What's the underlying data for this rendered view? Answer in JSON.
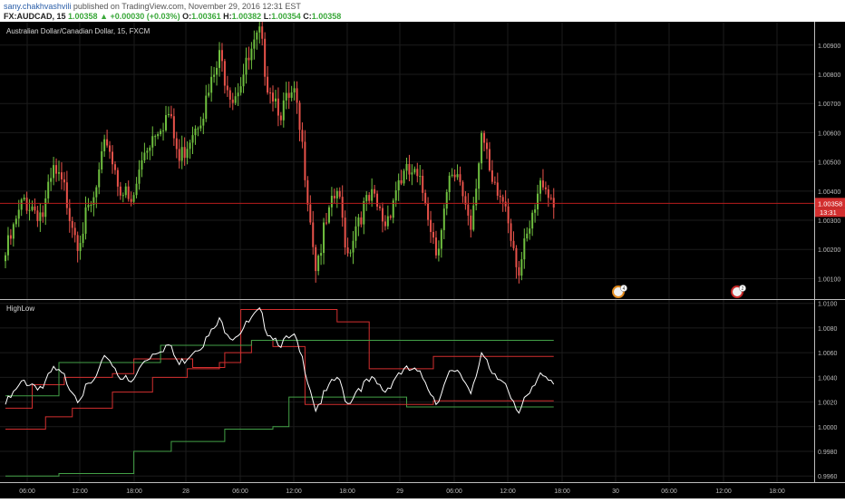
{
  "header": {
    "author": "sany.chakhvashvili",
    "published": "published on TradingView.com, November 29, 2016 12:31 EST",
    "symbol": "FX:AUDCAD, 15",
    "last": "1.00358",
    "change": "▲ +0.00030 (+0.03%)",
    "o_label": "O:",
    "o": "1.00361",
    "h_label": "H:",
    "h": "1.00382",
    "l_label": "L:",
    "l": "1.00354",
    "c_label": "C:",
    "c": "1.00358"
  },
  "colors": {
    "bull": "#6fbf3f",
    "bear": "#e8524a",
    "grid": "#1c1c1c",
    "last_line": "#b71c1c",
    "price_tag": "#d32f2f",
    "upper_band": "#d32f2f",
    "lower_band": "#43a047",
    "close_line": "#ffffff"
  },
  "chart_data": [
    {
      "type": "candlestick",
      "title": "Australian Dollar/Canadian Dollar, 15, FXCM",
      "ylim": [
        1.0003,
        1.0098
      ],
      "y_ticks": [
        "1.00900",
        "1.00800",
        "1.00700",
        "1.00600",
        "1.00500",
        "1.00400",
        "1.00300",
        "1.00200",
        "1.00100"
      ],
      "x_ticks": [
        "06:00",
        "12:00",
        "18:00",
        "28",
        "06:00",
        "12:00",
        "18:00",
        "29",
        "06:00",
        "12:00",
        "18:00",
        "30",
        "06:00",
        "12:00",
        "18:00"
      ],
      "last_price": "1.00358",
      "countdown": "13:31",
      "event_badges": [
        "4",
        "2"
      ],
      "anchors": [
        {
          "i": 0,
          "p": 1.0018
        },
        {
          "i": 7,
          "p": 1.0037
        },
        {
          "i": 14,
          "p": 1.0032
        },
        {
          "i": 18,
          "p": 1.0046
        },
        {
          "i": 22,
          "p": 1.004
        },
        {
          "i": 27,
          "p": 1.0024
        },
        {
          "i": 33,
          "p": 1.0036
        },
        {
          "i": 38,
          "p": 1.0058
        },
        {
          "i": 42,
          "p": 1.0044
        },
        {
          "i": 47,
          "p": 1.0034
        },
        {
          "i": 52,
          "p": 1.0054
        },
        {
          "i": 57,
          "p": 1.0063
        },
        {
          "i": 61,
          "p": 1.0066
        },
        {
          "i": 65,
          "p": 1.005
        },
        {
          "i": 70,
          "p": 1.0062
        },
        {
          "i": 75,
          "p": 1.007
        },
        {
          "i": 80,
          "p": 1.0085
        },
        {
          "i": 85,
          "p": 1.0073
        },
        {
          "i": 90,
          "p": 1.0082
        },
        {
          "i": 95,
          "p": 1.0093
        },
        {
          "i": 98,
          "p": 1.0078
        },
        {
          "i": 103,
          "p": 1.0068
        },
        {
          "i": 108,
          "p": 1.0072
        },
        {
          "i": 112,
          "p": 1.0048
        },
        {
          "i": 116,
          "p": 1.0015
        },
        {
          "i": 120,
          "p": 1.0028
        },
        {
          "i": 124,
          "p": 1.004
        },
        {
          "i": 128,
          "p": 1.0019
        },
        {
          "i": 132,
          "p": 1.0032
        },
        {
          "i": 137,
          "p": 1.0037
        },
        {
          "i": 142,
          "p": 1.0029
        },
        {
          "i": 147,
          "p": 1.0044
        },
        {
          "i": 152,
          "p": 1.0046
        },
        {
          "i": 157,
          "p": 1.0038
        },
        {
          "i": 161,
          "p": 1.002
        },
        {
          "i": 166,
          "p": 1.0042
        },
        {
          "i": 170,
          "p": 1.0043
        },
        {
          "i": 174,
          "p": 1.0029
        },
        {
          "i": 178,
          "p": 1.006
        },
        {
          "i": 182,
          "p": 1.004
        },
        {
          "i": 187,
          "p": 1.0036
        },
        {
          "i": 192,
          "p": 1.0013
        },
        {
          "i": 197,
          "p": 1.0029
        },
        {
          "i": 201,
          "p": 1.0045
        },
        {
          "i": 205,
          "p": 1.0036
        }
      ]
    },
    {
      "type": "line",
      "title": "HighLow",
      "ylim": [
        0.9955,
        1.0102
      ],
      "y_ticks": [
        "1.0100",
        "1.0080",
        "1.0060",
        "1.0040",
        "1.0020",
        "1.0000",
        "0.9980",
        "0.9960"
      ],
      "series": [
        {
          "kind": "upper_band",
          "steps": [
            [
              0,
              0.9998
            ],
            [
              15,
              1.0008
            ],
            [
              25,
              1.0015
            ],
            [
              40,
              1.0028
            ],
            [
              55,
              1.004
            ],
            [
              68,
              1.0047
            ],
            [
              80,
              1.0052
            ],
            [
              88,
              1.0095
            ],
            [
              124,
              1.0085
            ],
            [
              136,
              1.0047
            ],
            [
              160,
              1.0057
            ],
            [
              205,
              1.0057
            ]
          ]
        },
        {
          "kind": "lower_band",
          "steps": [
            [
              0,
              0.996
            ],
            [
              20,
              0.9962
            ],
            [
              48,
              0.998
            ],
            [
              62,
              0.9988
            ],
            [
              82,
              0.9998
            ],
            [
              100,
              1.0
            ],
            [
              106,
              1.0024
            ],
            [
              150,
              1.0016
            ],
            [
              205,
              1.0016
            ]
          ]
        },
        {
          "kind": "upper_band",
          "steps": [
            [
              0,
              1.0015
            ],
            [
              10,
              1.0034
            ],
            [
              22,
              1.004
            ],
            [
              40,
              1.0043
            ],
            [
              48,
              1.0055
            ],
            [
              60,
              1.0055
            ],
            [
              70,
              1.0048
            ],
            [
              82,
              1.006
            ],
            [
              92,
              1.007
            ],
            [
              100,
              1.0065
            ],
            [
              112,
              1.0018
            ],
            [
              160,
              1.0021
            ],
            [
              205,
              1.0021
            ]
          ]
        },
        {
          "kind": "lower_band",
          "steps": [
            [
              0,
              1.0025
            ],
            [
              20,
              1.0052
            ],
            [
              50,
              1.0052
            ],
            [
              58,
              1.0066
            ],
            [
              75,
              1.0066
            ],
            [
              92,
              1.007
            ],
            [
              205,
              1.007
            ]
          ]
        }
      ]
    }
  ]
}
